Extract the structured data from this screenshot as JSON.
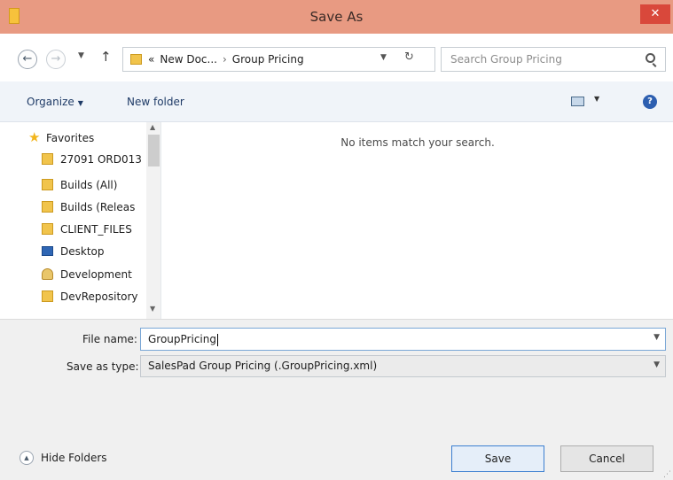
{
  "window": {
    "title": "Save As",
    "close_label": "✕"
  },
  "nav": {
    "back_glyph": "←",
    "forward_glyph": "→",
    "recent_glyph": "▼",
    "up_glyph": "↑",
    "address_prefix": "«",
    "address_path": [
      "New Doc...",
      "Group Pricing"
    ],
    "address_separator": "›",
    "refresh_glyph": "↻",
    "search_placeholder": "Search Group Pricing"
  },
  "toolbar": {
    "organize_label": "Organize",
    "new_folder_label": "New folder",
    "help_label": "?"
  },
  "sidebar": {
    "items": [
      {
        "label": "Favorites",
        "icon": "star-icon",
        "indent": 0
      },
      {
        "label": "27091 ORD013",
        "icon": "folder-icon",
        "indent": 1
      },
      {
        "label": "Builds (All)",
        "icon": "folder-icon",
        "indent": 1
      },
      {
        "label": "Builds (Releas",
        "icon": "folder-icon",
        "indent": 1
      },
      {
        "label": "CLIENT_FILES",
        "icon": "folder-icon",
        "indent": 1
      },
      {
        "label": "Desktop",
        "icon": "desktop-icon",
        "indent": 1
      },
      {
        "label": "Development",
        "icon": "user-folder-icon",
        "indent": 1
      },
      {
        "label": "DevRepository",
        "icon": "folder-icon",
        "indent": 1
      }
    ]
  },
  "file_pane": {
    "empty_message": "No items match your search."
  },
  "form": {
    "file_name_label": "File name:",
    "file_name_value": "GroupPricing",
    "save_type_label": "Save as type:",
    "save_type_value": "SalesPad Group Pricing (.GroupPricing.xml)"
  },
  "footer": {
    "hide_folders_label": "Hide Folders",
    "save_label": "Save",
    "cancel_label": "Cancel"
  },
  "colors": {
    "titlebar": "#e89a82",
    "close": "#d9483b",
    "accent": "#3c7fd0"
  }
}
